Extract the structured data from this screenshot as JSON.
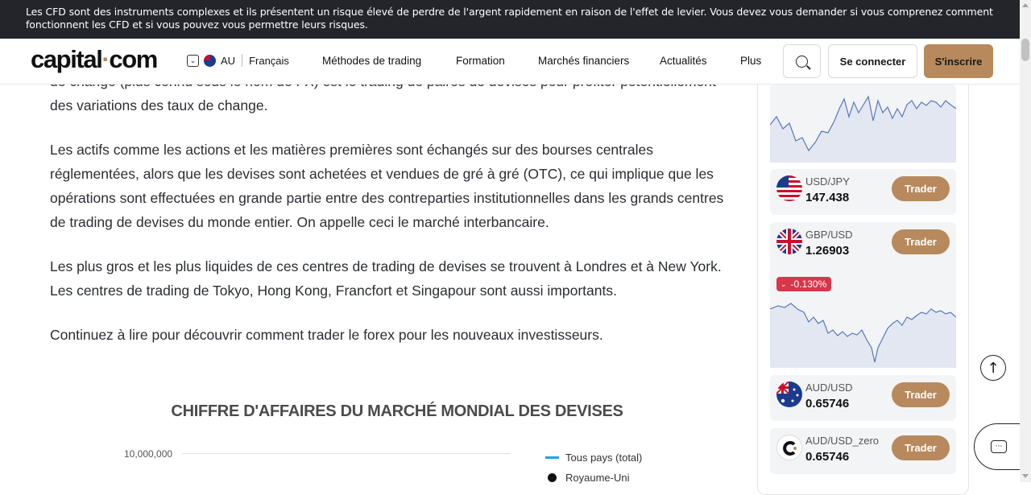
{
  "risk_banner": "Les CFD sont des instruments complexes et ils présentent un risque élevé de perdre de l'argent rapidement en raison de l'effet de levier. Vous devez vous demander si vous comprenez comment fonctionnent les CFD et si vous pouvez vous permettre leurs risques.",
  "header": {
    "logo_text_a": "capital",
    "logo_dot": "·",
    "logo_text_b": "com",
    "region": "AU",
    "language": "Français",
    "menu": [
      "Méthodes de trading",
      "Formation",
      "Marchés financiers",
      "Actualités",
      "Plus"
    ],
    "login": "Se connecter",
    "signup": "S'inscrire"
  },
  "article": {
    "p0": "de change (plus connu sous le nom de FX) est le trading de paires de devises pour profiter potentiellement des variations des taux de change.",
    "p1": "Les actifs comme les actions et les matières premières sont échangés sur des bourses centrales réglementées, alors que les devises sont achetées et vendues de gré à gré (OTC), ce qui implique que les opérations sont effectuées en grande partie entre des contreparties institutionnelles dans les grands centres de trading de devises du monde entier. On appelle ceci le marché interbancaire.",
    "p2": "Les plus gros et les plus liquides de ces centres de trading de devises se trouvent à Londres et à New York. Les centres de trading de Tokyo, Hong Kong, Francfort et Singapour sont aussi importants.",
    "p3": "Continuez à lire pour découvrir comment trader le forex pour les nouveaux investisseurs."
  },
  "chart": {
    "title": "CHIFFRE D'AFFAIRES DU MARCHÉ MONDIAL DES DEVISES",
    "tick": "10,000,000",
    "legend": [
      "Tous pays (total)",
      "Royaume-Uni"
    ],
    "colors": {
      "total": "#1ea1f2",
      "uk": "#111111"
    }
  },
  "sidebar": {
    "instruments": [
      {
        "pair": "USD/JPY",
        "price": "147.438",
        "action": "Trader",
        "flag": "us-flag-icon"
      },
      {
        "pair": "GBP/USD",
        "price": "1.26903",
        "action": "Trader",
        "flag": "uk-flag-icon",
        "change": "-0.130%"
      },
      {
        "pair": "AUD/USD",
        "price": "0.65746",
        "action": "Trader",
        "flag": "au-flag-icon"
      },
      {
        "pair": "AUD/USD_zero",
        "price": "0.65746",
        "action": "Trader",
        "flag": "capital-logo-icon"
      }
    ]
  },
  "colors": {
    "accent": "#b7895c",
    "negative": "#d8364a",
    "positive": "#2fbf5f",
    "banner": "#23252b"
  }
}
